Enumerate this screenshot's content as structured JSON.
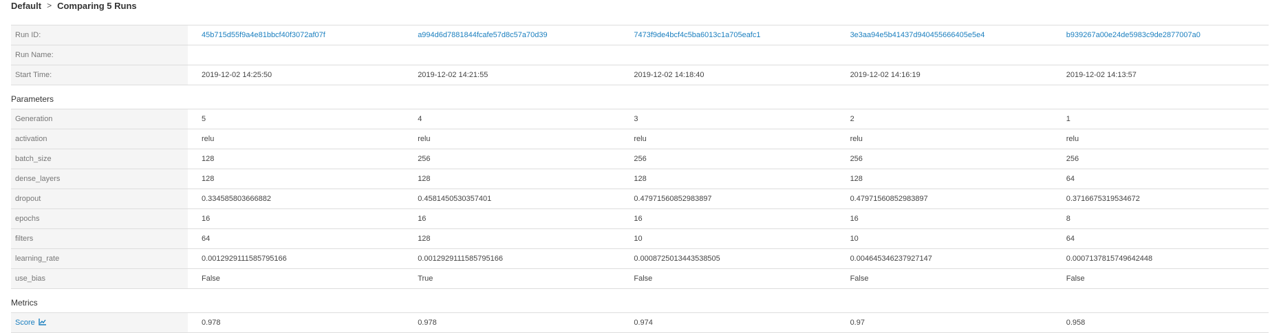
{
  "breadcrumb": {
    "experiment": "Default",
    "separator": ">",
    "current": "Comparing 5 Runs"
  },
  "run_info": {
    "run_id_label": "Run ID:",
    "run_name_label": "Run Name:",
    "start_time_label": "Start Time:",
    "runs": [
      {
        "id": "45b715d55f9a4e81bbcf40f3072af07f",
        "name": "",
        "start": "2019-12-02 14:25:50"
      },
      {
        "id": "a994d6d7881844fcafe57d8c57a70d39",
        "name": "",
        "start": "2019-12-02 14:21:55"
      },
      {
        "id": "7473f9de4bcf4c5ba6013c1a705eafc1",
        "name": "",
        "start": "2019-12-02 14:18:40"
      },
      {
        "id": "3e3aa94e5b41437d940455666405e5e4",
        "name": "",
        "start": "2019-12-02 14:16:19"
      },
      {
        "id": "b939267a00e24de5983c9de2877007a0",
        "name": "",
        "start": "2019-12-02 14:13:57"
      }
    ]
  },
  "parameters": {
    "heading": "Parameters",
    "rows": [
      {
        "key": "Generation",
        "values": [
          "5",
          "4",
          "3",
          "2",
          "1"
        ]
      },
      {
        "key": "activation",
        "values": [
          "relu",
          "relu",
          "relu",
          "relu",
          "relu"
        ]
      },
      {
        "key": "batch_size",
        "values": [
          "128",
          "256",
          "256",
          "256",
          "256"
        ]
      },
      {
        "key": "dense_layers",
        "values": [
          "128",
          "128",
          "128",
          "128",
          "64"
        ]
      },
      {
        "key": "dropout",
        "values": [
          "0.334585803666882",
          "0.4581450530357401",
          "0.47971560852983897",
          "0.47971560852983897",
          "0.3716675319534672"
        ]
      },
      {
        "key": "epochs",
        "values": [
          "16",
          "16",
          "16",
          "16",
          "8"
        ]
      },
      {
        "key": "filters",
        "values": [
          "64",
          "128",
          "10",
          "10",
          "64"
        ]
      },
      {
        "key": "learning_rate",
        "values": [
          "0.0012929111585795166",
          "0.0012929111585795166",
          "0.0008725013443538505",
          "0.004645346237927147",
          "0.0007137815749642448"
        ]
      },
      {
        "key": "use_bias",
        "values": [
          "False",
          "True",
          "False",
          "False",
          "False"
        ]
      }
    ]
  },
  "metrics": {
    "heading": "Metrics",
    "rows": [
      {
        "key": "Score",
        "icon": "line-chart-icon",
        "values": [
          "0.978",
          "0.978",
          "0.974",
          "0.97",
          "0.958"
        ]
      }
    ]
  },
  "colors": {
    "link": "#1b7fbf",
    "label_bg": "#f5f5f5",
    "border": "#dddddd"
  }
}
